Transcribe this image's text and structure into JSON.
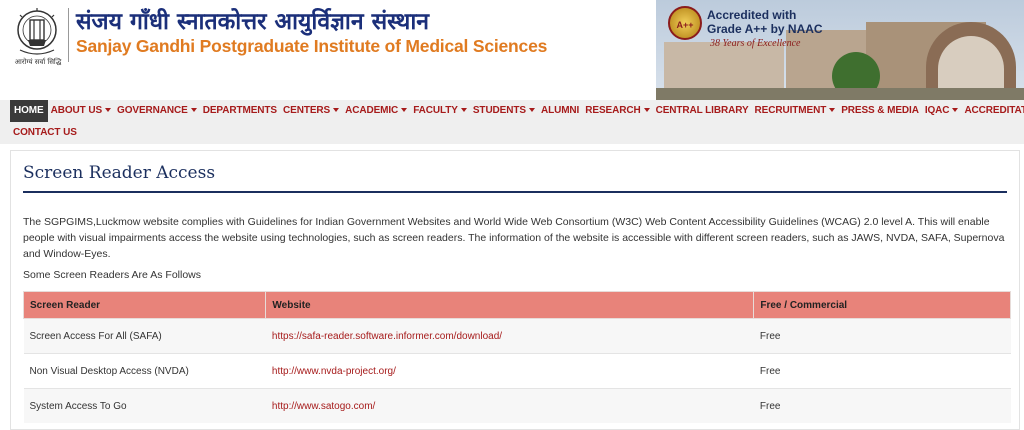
{
  "header": {
    "title_hindi": "संजय गाँधी स्नातकोत्तर आयुर्विज्ञान संस्थान",
    "title_english": "Sanjay Gandhi Postgraduate Institute of Medical Sciences",
    "logo_motto": "आरोग्यं सर्वा सिद्धि",
    "logo_icon": "institute-emblem-icon",
    "banner": {
      "badge": "A++",
      "accreditation_line1": "Accredited with",
      "accreditation_line2": "Grade A++ by NAAC",
      "years": "38 Years of Excellence"
    }
  },
  "nav": {
    "row1": [
      {
        "label": "HOME",
        "active": true,
        "dropdown": false
      },
      {
        "label": "ABOUT US",
        "dropdown": true
      },
      {
        "label": "GOVERNANCE",
        "dropdown": true
      },
      {
        "label": "DEPARTMENTS",
        "dropdown": false
      },
      {
        "label": "CENTERS",
        "dropdown": true
      },
      {
        "label": "ACADEMIC",
        "dropdown": true
      },
      {
        "label": "FACULTY",
        "dropdown": true
      },
      {
        "label": "STUDENTS",
        "dropdown": true
      },
      {
        "label": "ALUMNI",
        "dropdown": false
      },
      {
        "label": "RESEARCH",
        "dropdown": true
      },
      {
        "label": "CENTRAL LIBRARY",
        "dropdown": false
      },
      {
        "label": "RECRUITMENT",
        "dropdown": true
      },
      {
        "label": "PRESS & MEDIA",
        "dropdown": false
      },
      {
        "label": "IQAC",
        "dropdown": true
      },
      {
        "label": "ACCREDITATION",
        "dropdown": true
      }
    ],
    "row2": [
      {
        "label": "CONTACT US",
        "dropdown": false
      }
    ]
  },
  "content": {
    "title": "Screen Reader Access",
    "paragraph": "The SGPGIMS,Luckmow website complies with Guidelines for Indian Government Websites and World Wide Web Consortium (W3C) Web Content Accessibility Guidelines (WCAG) 2.0 level A. This will enable people with visual impairments access the website using technologies, such as screen readers. The information of the website is accessible with different screen readers, such as JAWS, NVDA, SAFA, Supernova and Window-Eyes.",
    "subheading": "Some Screen Readers Are As Follows",
    "table": {
      "headers": [
        "Screen Reader",
        "Website",
        "Free / Commercial"
      ],
      "rows": [
        [
          "Screen Access For All (SAFA)",
          "https://safa-reader.software.informer.com/download/",
          "Free"
        ],
        [
          "Non Visual Desktop Access (NVDA)",
          "http://www.nvda-project.org/",
          "Free"
        ],
        [
          "System Access To Go",
          "http://www.satogo.com/",
          "Free"
        ]
      ]
    }
  },
  "colors": {
    "brand_blue": "#1b2f7a",
    "brand_orange": "#e07b21",
    "nav_red": "#a61b1b",
    "table_header": "#e8837a"
  }
}
